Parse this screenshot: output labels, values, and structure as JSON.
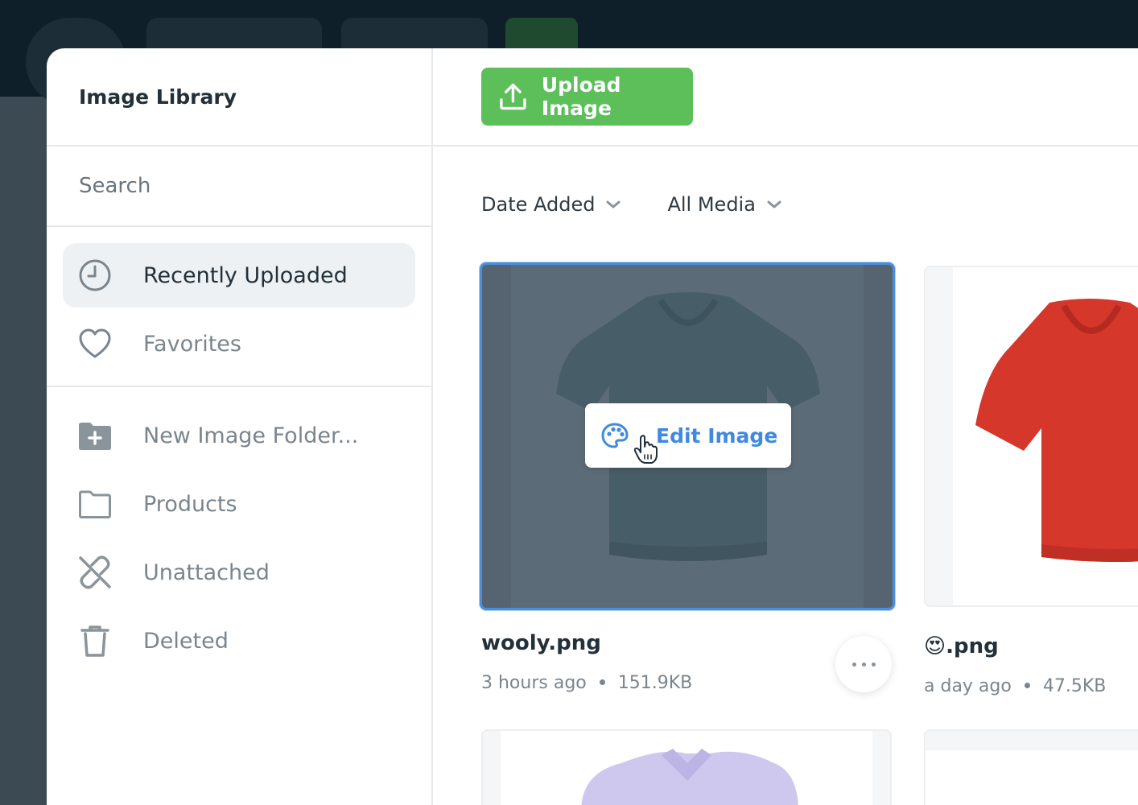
{
  "library": {
    "title": "Image Library",
    "search_placeholder": "Search"
  },
  "nav": {
    "items": [
      {
        "label": "Recently Uploaded",
        "icon": "clock-icon",
        "active": true
      },
      {
        "label": "Favorites",
        "icon": "heart-icon",
        "active": false
      }
    ]
  },
  "folders": {
    "items": [
      {
        "label": "New Image Folder...",
        "icon": "folder-plus-icon"
      },
      {
        "label": "Products",
        "icon": "folder-icon"
      },
      {
        "label": "Unattached",
        "icon": "unlink-icon"
      },
      {
        "label": "Deleted",
        "icon": "trash-icon"
      }
    ]
  },
  "toolbar": {
    "upload_label": "Upload Image"
  },
  "filters": {
    "sort": "Date Added",
    "type": "All Media"
  },
  "images": [
    {
      "name": "wooly.png",
      "time": "3 hours ago",
      "size": "151.9KB",
      "selected": true,
      "hover_action": "Edit Image",
      "shirt_color": "#4e6b70"
    },
    {
      "name": "😍.png",
      "time": "a day ago",
      "size": "47.5KB",
      "selected": false,
      "shirt_color": "#d6372b"
    }
  ],
  "colors": {
    "accent_green": "#5cbf5a",
    "selection_blue": "#4a8fdd",
    "link_blue": "#3f8ae0"
  }
}
